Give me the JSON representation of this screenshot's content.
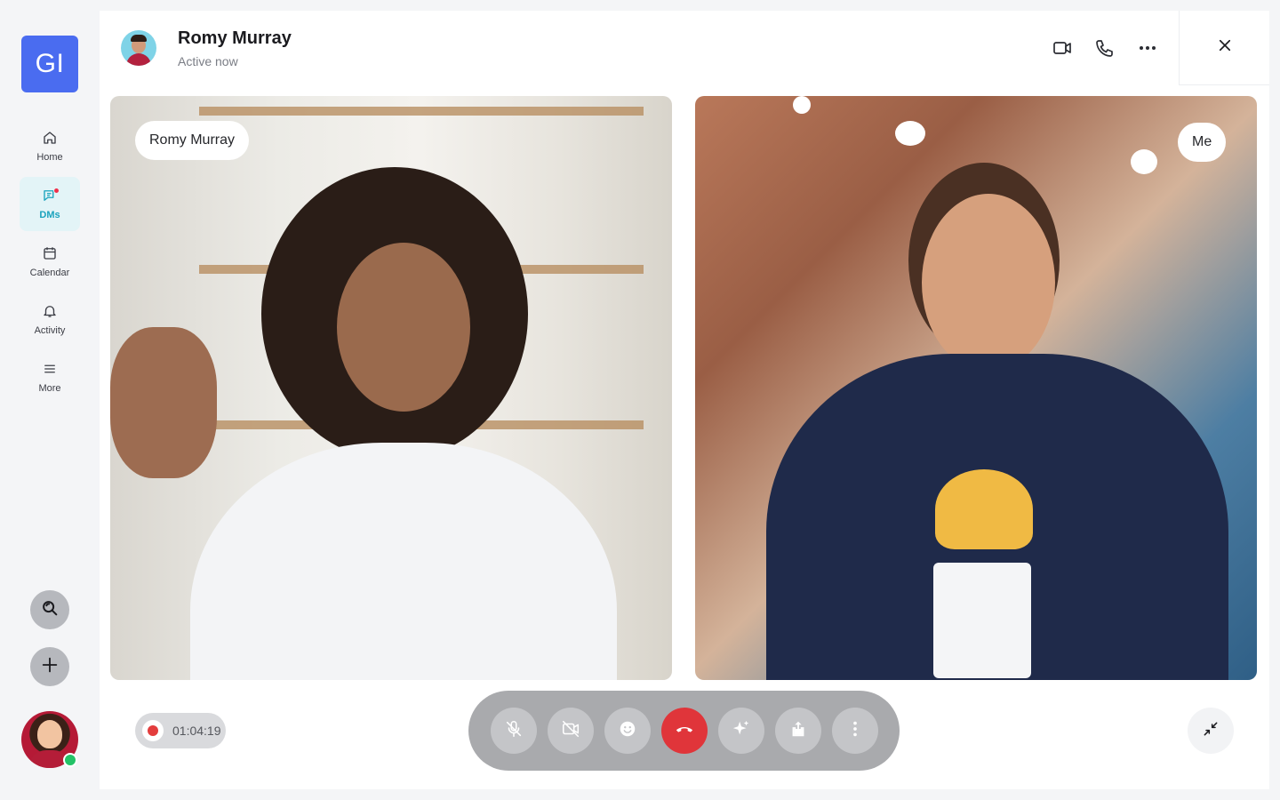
{
  "app": {
    "logo_text": "GI",
    "brand_color": "#4a6cf0",
    "accent_color": "#1aa3bd"
  },
  "nav": {
    "items": [
      {
        "label": "Home",
        "icon": "home-icon",
        "active": false
      },
      {
        "label": "DMs",
        "icon": "chat-icon",
        "active": true,
        "has_notification": true
      },
      {
        "label": "Calendar",
        "icon": "calendar-icon",
        "active": false
      },
      {
        "label": "Activity",
        "icon": "bell-icon",
        "active": false
      },
      {
        "label": "More",
        "icon": "menu-icon",
        "active": false
      }
    ]
  },
  "rail_actions": {
    "search_icon": "search-icon",
    "add_icon": "plus-icon",
    "user_status": "online"
  },
  "header": {
    "contact_name": "Romy Murray",
    "contact_status": "Active now",
    "actions": [
      "video-icon",
      "phone-icon",
      "more-horizontal-icon"
    ],
    "close_icon": "close-icon"
  },
  "call": {
    "remote_label": "Romy Murray",
    "self_label": "Me",
    "recording_time": "01:04:19",
    "recording_color": "#e33d3d",
    "controls": [
      {
        "name": "mute-button",
        "icon": "mic-off-icon"
      },
      {
        "name": "camera-button",
        "icon": "video-off-icon"
      },
      {
        "name": "reactions-button",
        "icon": "smile-icon"
      },
      {
        "name": "end-call-button",
        "icon": "phone-hangup-icon",
        "color": "#e0353a"
      },
      {
        "name": "effects-button",
        "icon": "sparkle-icon"
      },
      {
        "name": "share-button",
        "icon": "share-icon"
      },
      {
        "name": "more-options-button",
        "icon": "more-vertical-icon"
      }
    ],
    "minimize_icon": "minimize-icon"
  }
}
